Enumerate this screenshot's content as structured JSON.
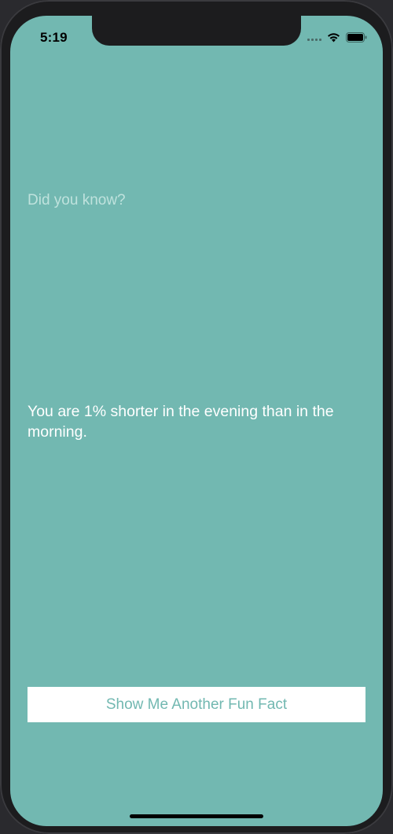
{
  "status_bar": {
    "time": "5:19",
    "icons": [
      "signal-icon",
      "wifi-icon",
      "battery-icon"
    ]
  },
  "main": {
    "title": "Did you know?",
    "fact": "You are 1% shorter in the evening than in the morning.",
    "button_label": "Show Me Another Fun Fact"
  },
  "colors": {
    "background": "#72b8b1",
    "title_text": "#bfe2dd",
    "fact_text": "#ffffff",
    "button_background": "#ffffff",
    "button_text": "#72b8b1"
  }
}
